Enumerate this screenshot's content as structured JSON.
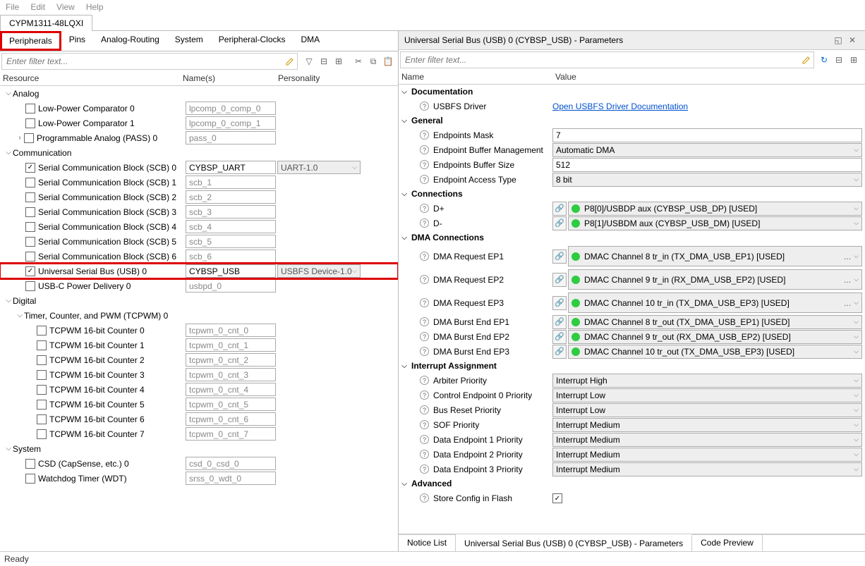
{
  "menubar": [
    "File",
    "Edit",
    "View",
    "Help"
  ],
  "doc_tab": "CYPM1311-48LQXI",
  "left": {
    "tabs": [
      "Peripherals",
      "Pins",
      "Analog-Routing",
      "System",
      "Peripheral-Clocks",
      "DMA"
    ],
    "active_tab": 0,
    "filter_placeholder": "Enter filter text...",
    "columns": {
      "resource": "Resource",
      "names": "Name(s)",
      "personality": "Personality"
    },
    "tree": [
      {
        "type": "group",
        "depth": 0,
        "label": "Analog"
      },
      {
        "type": "leaf",
        "depth": 0,
        "checked": false,
        "label": "Low-Power Comparator 0",
        "name": "lpcomp_0_comp_0"
      },
      {
        "type": "leaf",
        "depth": 0,
        "checked": false,
        "label": "Low-Power Comparator 1",
        "name": "lpcomp_0_comp_1"
      },
      {
        "type": "leaf",
        "depth": 0,
        "expander": true,
        "checked": false,
        "label": "Programmable Analog (PASS) 0",
        "name": "pass_0"
      },
      {
        "type": "group",
        "depth": 0,
        "label": "Communication"
      },
      {
        "type": "leaf",
        "depth": 0,
        "checked": true,
        "label": "Serial Communication Block (SCB) 0",
        "name": "CYBSP_UART",
        "name_active": true,
        "personality": "UART-1.0"
      },
      {
        "type": "leaf",
        "depth": 0,
        "checked": false,
        "label": "Serial Communication Block (SCB) 1",
        "name": "scb_1"
      },
      {
        "type": "leaf",
        "depth": 0,
        "checked": false,
        "label": "Serial Communication Block (SCB) 2",
        "name": "scb_2"
      },
      {
        "type": "leaf",
        "depth": 0,
        "checked": false,
        "label": "Serial Communication Block (SCB) 3",
        "name": "scb_3"
      },
      {
        "type": "leaf",
        "depth": 0,
        "checked": false,
        "label": "Serial Communication Block (SCB) 4",
        "name": "scb_4"
      },
      {
        "type": "leaf",
        "depth": 0,
        "checked": false,
        "label": "Serial Communication Block (SCB) 5",
        "name": "scb_5"
      },
      {
        "type": "leaf",
        "depth": 0,
        "checked": false,
        "label": "Serial Communication Block (SCB) 6",
        "name": "scb_6"
      },
      {
        "type": "leaf",
        "depth": 0,
        "checked": true,
        "label": "Universal Serial Bus (USB) 0",
        "name": "CYBSP_USB",
        "name_active": true,
        "personality": "USBFS Device-1.0",
        "highlight": true
      },
      {
        "type": "leaf",
        "depth": 0,
        "checked": false,
        "label": "USB-C Power Delivery 0",
        "name": "usbpd_0"
      },
      {
        "type": "group",
        "depth": 0,
        "label": "Digital"
      },
      {
        "type": "group",
        "depth": 1,
        "label": "Timer, Counter, and PWM (TCPWM) 0"
      },
      {
        "type": "leaf",
        "depth": 1,
        "checked": false,
        "label": "TCPWM 16-bit Counter 0",
        "name": "tcpwm_0_cnt_0"
      },
      {
        "type": "leaf",
        "depth": 1,
        "checked": false,
        "label": "TCPWM 16-bit Counter 1",
        "name": "tcpwm_0_cnt_1"
      },
      {
        "type": "leaf",
        "depth": 1,
        "checked": false,
        "label": "TCPWM 16-bit Counter 2",
        "name": "tcpwm_0_cnt_2"
      },
      {
        "type": "leaf",
        "depth": 1,
        "checked": false,
        "label": "TCPWM 16-bit Counter 3",
        "name": "tcpwm_0_cnt_3"
      },
      {
        "type": "leaf",
        "depth": 1,
        "checked": false,
        "label": "TCPWM 16-bit Counter 4",
        "name": "tcpwm_0_cnt_4"
      },
      {
        "type": "leaf",
        "depth": 1,
        "checked": false,
        "label": "TCPWM 16-bit Counter 5",
        "name": "tcpwm_0_cnt_5"
      },
      {
        "type": "leaf",
        "depth": 1,
        "checked": false,
        "label": "TCPWM 16-bit Counter 6",
        "name": "tcpwm_0_cnt_6"
      },
      {
        "type": "leaf",
        "depth": 1,
        "checked": false,
        "label": "TCPWM 16-bit Counter 7",
        "name": "tcpwm_0_cnt_7"
      },
      {
        "type": "group",
        "depth": 0,
        "label": "System"
      },
      {
        "type": "leaf",
        "depth": 0,
        "checked": false,
        "label": "CSD (CapSense, etc.) 0",
        "name": "csd_0_csd_0"
      },
      {
        "type": "leaf",
        "depth": 0,
        "checked": false,
        "label": "Watchdog Timer (WDT)",
        "name": "srss_0_wdt_0"
      }
    ]
  },
  "right": {
    "title": "Universal Serial Bus (USB) 0 (CYBSP_USB) - Parameters",
    "filter_placeholder": "Enter filter text...",
    "columns": {
      "name": "Name",
      "value": "Value"
    },
    "groups": [
      {
        "label": "Documentation",
        "rows": [
          {
            "kind": "link",
            "name": "USBFS Driver",
            "value": "Open USBFS Driver Documentation"
          }
        ]
      },
      {
        "label": "General",
        "rows": [
          {
            "kind": "text",
            "name": "Endpoints Mask",
            "value": "7"
          },
          {
            "kind": "select",
            "name": "Endpoint Buffer Management",
            "value": "Automatic DMA"
          },
          {
            "kind": "text",
            "name": "Endpoints Buffer Size",
            "value": "512"
          },
          {
            "kind": "select",
            "name": "Endpoint Access Type",
            "value": "8 bit"
          }
        ]
      },
      {
        "label": "Connections",
        "rows": [
          {
            "kind": "conn",
            "name": "D+",
            "value": "P8[0]/USBDP aux (CYBSP_USB_DP) [USED]"
          },
          {
            "kind": "conn",
            "name": "D-",
            "value": "P8[1]/USBDM aux (CYBSP_USB_DM) [USED]"
          }
        ]
      },
      {
        "label": "DMA Connections",
        "rows": [
          {
            "kind": "conn",
            "name": "DMA Request EP1",
            "value": "DMAC Channel 8 tr_in (TX_DMA_USB_EP1) [USED]",
            "more": true,
            "tall": true
          },
          {
            "kind": "conn",
            "name": "DMA Request EP2",
            "value": "DMAC Channel 9 tr_in (RX_DMA_USB_EP2) [USED]",
            "more": true,
            "tall": true
          },
          {
            "kind": "conn",
            "name": "DMA Request EP3",
            "value": "DMAC Channel 10 tr_in (TX_DMA_USB_EP3) [USED]",
            "more": true,
            "tall": true
          },
          {
            "kind": "conn",
            "name": "DMA Burst End EP1",
            "value": "DMAC Channel 8 tr_out (TX_DMA_USB_EP1) [USED]"
          },
          {
            "kind": "conn",
            "name": "DMA Burst End EP2",
            "value": "DMAC Channel 9 tr_out (RX_DMA_USB_EP2) [USED]"
          },
          {
            "kind": "conn",
            "name": "DMA Burst End EP3",
            "value": "DMAC Channel 10 tr_out (TX_DMA_USB_EP3) [USED]"
          }
        ]
      },
      {
        "label": "Interrupt Assignment",
        "rows": [
          {
            "kind": "select",
            "name": "Arbiter Priority",
            "value": "Interrupt High"
          },
          {
            "kind": "select",
            "name": "Control Endpoint 0 Priority",
            "value": "Interrupt Low"
          },
          {
            "kind": "select",
            "name": "Bus Reset Priority",
            "value": "Interrupt Low"
          },
          {
            "kind": "select",
            "name": "SOF Priority",
            "value": "Interrupt Medium"
          },
          {
            "kind": "select",
            "name": "Data Endpoint 1 Priority",
            "value": "Interrupt Medium"
          },
          {
            "kind": "select",
            "name": "Data Endpoint 2 Priority",
            "value": "Interrupt Medium"
          },
          {
            "kind": "select",
            "name": "Data Endpoint 3 Priority",
            "value": "Interrupt Medium"
          }
        ]
      },
      {
        "label": "Advanced",
        "rows": [
          {
            "kind": "check",
            "name": "Store Config in Flash",
            "checked": true
          }
        ]
      }
    ],
    "bottom_tabs": [
      "Notice List",
      "Universal Serial Bus (USB) 0 (CYBSP_USB) - Parameters",
      "Code Preview"
    ],
    "active_bottom": 1
  },
  "status": "Ready"
}
